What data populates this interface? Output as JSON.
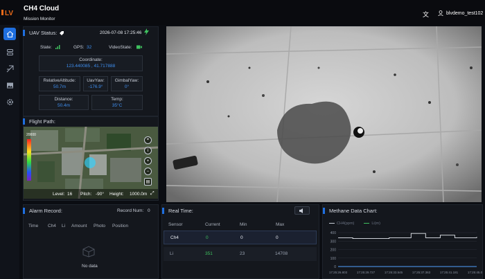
{
  "app": {
    "title": "CH4 Cloud",
    "subtitle": "Mission Monitor",
    "logo_text": "LV",
    "user": "blvdemo_test102"
  },
  "icons": {
    "language": "translate-icon",
    "user": "user-icon"
  },
  "sidebar": {
    "items": [
      {
        "name": "home-icon",
        "active": true
      },
      {
        "name": "list-icon"
      },
      {
        "name": "drone-icon"
      },
      {
        "name": "image-icon"
      },
      {
        "name": "settings-icon"
      }
    ]
  },
  "uav": {
    "title": "UAV Status:",
    "datetime": "2026-07-08 17:25:46",
    "state_label": "State:",
    "gps_label": "GPS:",
    "gps_value": "32",
    "video_state_label": "VideoState:",
    "coordinate_label": "Coordinate:",
    "coordinate_value": "123.440085 , 41.717888",
    "rel_alt_label": "RelativeAltitude:",
    "rel_alt_value": "50.7m",
    "uav_yaw_label": "UavYaw:",
    "uav_yaw_value": "-176.9°",
    "gimbal_yaw_label": "GimbalYaw:",
    "gimbal_yaw_value": "0°",
    "distance_label": "Distance:",
    "distance_value": "50.4m",
    "temp_label": "Temp:",
    "temp_value": "35°C"
  },
  "flight": {
    "title": "Flight Path:",
    "legend_top": "20000",
    "level_label": "Level:",
    "level_value": "16",
    "pitch_label": "Pitch:",
    "pitch_value": "-90°",
    "height_label": "Height:",
    "height_value": "1000.0m"
  },
  "alarm": {
    "title": "Alarm Record:",
    "record_label": "Record Num:",
    "record_value": "0",
    "columns": [
      "Time",
      "Ch4",
      "Li",
      "Amount",
      "Photo",
      "Position"
    ],
    "empty": "No data"
  },
  "realtime": {
    "title": "Real Time:",
    "columns": [
      "Sensor",
      "Current",
      "Min",
      "Max"
    ],
    "rows": [
      {
        "sensor": "Ch4",
        "current": "0",
        "min": "0",
        "max": "0"
      },
      {
        "sensor": "Li",
        "current": "351",
        "min": "23",
        "max": "14708"
      }
    ]
  },
  "methane": {
    "title": "Methane Data Chart:",
    "legend": [
      "CH4(ppm)",
      "Li(m)"
    ]
  },
  "chart_data": {
    "type": "line",
    "title": "Methane Data Chart:",
    "series": [
      {
        "name": "CH4(ppm)",
        "values": [
          0,
          0,
          0,
          0,
          0,
          0,
          0,
          0,
          0,
          0,
          0,
          0,
          0,
          0,
          0,
          0,
          0,
          0,
          0,
          0
        ]
      },
      {
        "name": "Li(m)",
        "values": [
          340,
          340,
          330,
          330,
          330,
          330,
          330,
          340,
          340,
          340,
          390,
          390,
          340,
          340,
          370,
          370,
          340,
          340,
          340,
          350
        ]
      }
    ],
    "x": [
      "17:25:26.803",
      "17:25:29.727",
      "17:25:33.545",
      "17:25:37.363",
      "17:25:41.181",
      "17:25:45.000"
    ],
    "yticks": [
      "400",
      "300",
      "200",
      "100",
      "0"
    ],
    "ylim": [
      0,
      400
    ]
  }
}
